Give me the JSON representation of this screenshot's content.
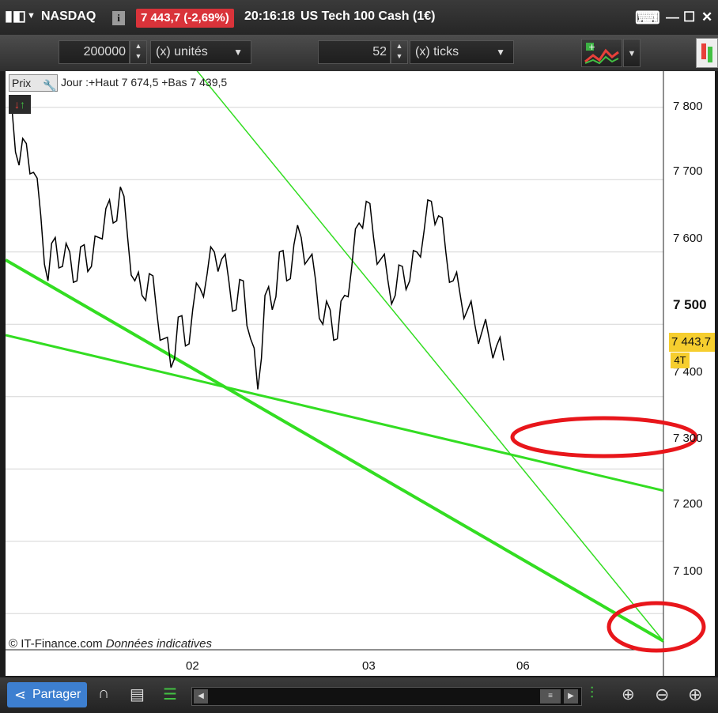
{
  "window": {
    "instrument": "NASDAQ",
    "info_label": "i",
    "price_change": "7 443,7 (-2,69%)",
    "time": "20:16:18",
    "description": "US Tech 100 Cash (1€)",
    "icons": [
      "window-icon",
      "dropdown-icon",
      "info-icon",
      "keyboard-icon",
      "minimize-icon",
      "maximize-icon",
      "close-icon"
    ],
    "colors": {
      "price_change_bg": "#d9333a"
    }
  },
  "toolbar": {
    "quantity_value": "200000",
    "quantity_unit": "(x) unités",
    "ticks_value": "52",
    "ticks_unit": "(x) ticks"
  },
  "chart": {
    "price_label": "Prix",
    "high_low": "Jour :+Haut 7 674,5 +Bas 7 439,5",
    "copyright_prefix": "© IT-Finance.com",
    "copyright_note": "Données indicatives",
    "last_price": "7 443,7",
    "timeframe": "4T",
    "y_ticks": [
      "7 800",
      "7 700",
      "7 600",
      "7 500",
      "7 400",
      "7 300",
      "7 200",
      "7 100"
    ],
    "x_ticks": [
      "02",
      "03",
      "06"
    ],
    "colors": {
      "trendline": "#33dd22",
      "price_line": "#000000",
      "annotation": "#e8161b",
      "last_price_bg": "#f6ce2e"
    }
  },
  "chart_data": {
    "type": "line",
    "x_ticks": [
      "02",
      "03",
      "06"
    ],
    "ylim": [
      7050,
      7850
    ],
    "series": [
      {
        "values": [
          7800,
          7720,
          7750,
          7710,
          7650,
          7560,
          7620,
          7580,
          7600,
          7560,
          7610,
          7580,
          7620,
          7660,
          7640,
          7690,
          7620,
          7560,
          7540,
          7570,
          7520,
          7480,
          7440,
          7510,
          7470,
          7520,
          7550,
          7570,
          7600,
          7590,
          7560,
          7520,
          7560,
          7480,
          7410,
          7540,
          7520,
          7600,
          7560,
          7610,
          7620,
          7590,
          7560,
          7500,
          7520,
          7480,
          7540,
          7580,
          7640,
          7670,
          7620,
          7590,
          7560,
          7540,
          7580,
          7560,
          7600,
          7630,
          7670,
          7650,
          7600,
          7560,
          7540,
          7520,
          7500,
          7490,
          7480,
          7470,
          7450
        ]
      }
    ],
    "trendlines": [
      {
        "from": {
          "x": "start",
          "y": 7589
        },
        "to": {
          "x": "end",
          "y": 7062
        }
      },
      {
        "from": {
          "x": "start",
          "y": 7485
        },
        "to": {
          "x": "end",
          "y": 7270
        }
      },
      {
        "from": {
          "x": "02",
          "y": 7860
        },
        "to": {
          "x": "end",
          "y": 7062
        }
      }
    ]
  },
  "bottom": {
    "share_label": "Partager"
  }
}
